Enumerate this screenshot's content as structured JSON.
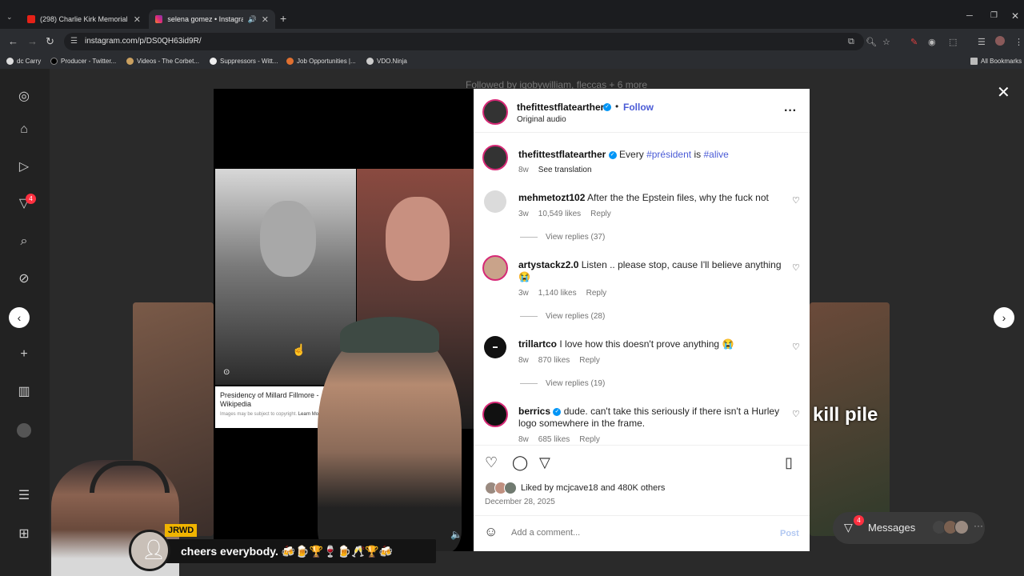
{
  "browser": {
    "tabs": [
      {
        "title": "(298) Charlie Kirk Memorial - H",
        "active": false
      },
      {
        "title": "selena gomez • Instagram",
        "active": true
      }
    ],
    "url": "instagram.com/p/DS0QH63id9R/",
    "bookmarks": [
      "dc Carry",
      "Producer - Twitter...",
      "Videos - The Corbet...",
      "Suppressors - Witt...",
      "Job Opportunities |...",
      "VDO.Ninja"
    ],
    "all_bookmarks": "All Bookmarks"
  },
  "background": {
    "followed_by": "Followed by iqobywilliam, fleccas + 6 more",
    "notification_count": "4"
  },
  "media": {
    "search_card_title": "Presidency of Millard Fillmore - Wikipedia",
    "search_card_note": "Images may be subject to copyright.",
    "search_card_link": "Learn More"
  },
  "post": {
    "author": "thefittestflatearther",
    "follow_label": "Follow",
    "audio": "Original audio",
    "caption_author": "thefittestflatearther",
    "caption_text": "Every",
    "caption_tag1": "#président",
    "caption_mid": "is",
    "caption_tag2": "#alive",
    "caption_age": "8w",
    "see_translation": "See translation",
    "comments": [
      {
        "user": "mehmetozt102",
        "text": "After the the Epstein files, why the fuck not",
        "age": "3w",
        "likes": "10,549 likes",
        "reply": "Reply",
        "view_replies": "View replies (37)"
      },
      {
        "user": "artystackz2.0",
        "text": "Listen .. please stop, cause I'll believe anything 😭",
        "age": "3w",
        "likes": "1,140 likes",
        "reply": "Reply",
        "view_replies": "View replies (28)"
      },
      {
        "user": "trillartco",
        "text": "I love how this doesn't prove anything 😭",
        "age": "8w",
        "likes": "870 likes",
        "reply": "Reply",
        "view_replies": "View replies (19)"
      },
      {
        "user": "berrics",
        "text": "dude. can't take this seriously if there isn't a Hurley logo somewhere in the frame.",
        "age": "8w",
        "likes": "685 likes",
        "reply": "Reply"
      }
    ],
    "liked_by_prefix": "Liked by",
    "liked_by_user": "mcjcave18",
    "liked_by_and": "and",
    "liked_by_others": "480K others",
    "date": "December 28, 2025",
    "comment_placeholder": "Add a comment...",
    "post_button": "Post"
  },
  "messages": {
    "label": "Messages",
    "count": "4"
  },
  "stream_overlay": {
    "name": "JRWD",
    "chat": "cheers everybody. 🍻🍺🏆🍷🍺🥂🏆🍻"
  }
}
